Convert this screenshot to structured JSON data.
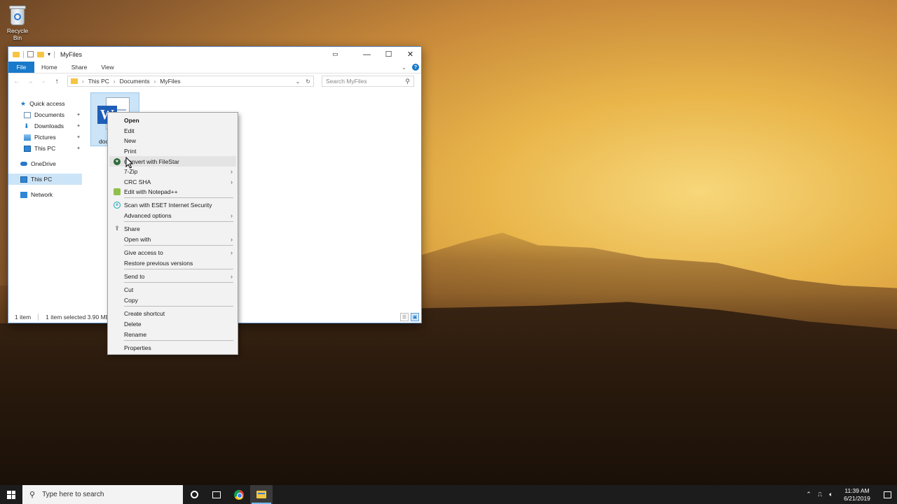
{
  "desktop": {
    "recycle_bin_label": "Recycle Bin"
  },
  "explorer": {
    "title": "MyFiles",
    "ribbon_tabs": [
      "File",
      "Home",
      "Share",
      "View"
    ],
    "address": {
      "segments": [
        "This PC",
        "Documents",
        "MyFiles"
      ]
    },
    "search_placeholder": "Search MyFiles",
    "nav": {
      "quick_access": "Quick access",
      "documents": "Documents",
      "downloads": "Downloads",
      "pictures": "Pictures",
      "this_pc_pinned": "This PC",
      "onedrive": "OneDrive",
      "this_pc": "This PC",
      "network": "Network"
    },
    "file": {
      "name": "doc"
    },
    "status": {
      "items": "1 item",
      "selected": "1 item selected  3.90 MB"
    }
  },
  "context_menu": {
    "open": "Open",
    "edit": "Edit",
    "new": "New",
    "print": "Print",
    "convert_filestar": "Convert with FileStar",
    "seven_zip": "7-Zip",
    "crc_sha": "CRC SHA",
    "notepadpp": "Edit with Notepad++",
    "eset": "Scan with ESET Internet Security",
    "advanced": "Advanced options",
    "share": "Share",
    "open_with": "Open with",
    "give_access": "Give access to",
    "restore": "Restore previous versions",
    "send_to": "Send to",
    "cut": "Cut",
    "copy": "Copy",
    "create_shortcut": "Create shortcut",
    "delete": "Delete",
    "rename": "Rename",
    "properties": "Properties"
  },
  "taskbar": {
    "search_placeholder": "Type here to search",
    "time": "11:39 AM",
    "date": "6/21/2019"
  },
  "icons": [
    "recycle-bin-icon",
    "folder-icon",
    "word-document-icon",
    "windows-logo-icon",
    "search-icon",
    "cortana-icon",
    "task-view-icon",
    "chrome-icon",
    "file-explorer-icon",
    "volume-icon",
    "notification-icon"
  ],
  "colors": {
    "accent": "#1979ca",
    "selection": "#cce4f7",
    "taskbar": "#1c1c1c",
    "menu_bg": "#f2f2f2"
  }
}
